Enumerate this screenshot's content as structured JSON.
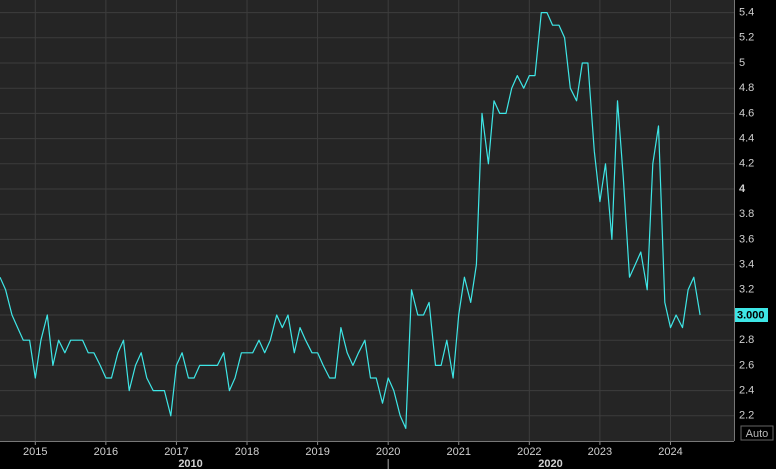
{
  "chart_data": {
    "type": "line",
    "title": "",
    "xlabel": "",
    "ylabel": "",
    "ylim": [
      2.0,
      5.5
    ],
    "yticks": [
      2.2,
      2.4,
      2.6,
      2.8,
      3.0,
      3.2,
      3.4,
      3.6,
      3.8,
      4.0,
      4.2,
      4.4,
      4.6,
      4.8,
      5.0,
      5.2,
      5.4
    ],
    "ytick_labels": [
      "2.2",
      "2.4",
      "2.6",
      "2.8",
      "3",
      "3.2",
      "3.4",
      "3.6",
      "3.8",
      "4",
      "4.2",
      "4.4",
      "4.6",
      "4.8",
      "5",
      "5.2",
      "5.4"
    ],
    "xticks": [
      2015,
      2016,
      2017,
      2018,
      2019,
      2020,
      2021,
      2022,
      2023,
      2024
    ],
    "xtick_labels": [
      "2015",
      "2016",
      "2017",
      "2018",
      "2019",
      "2020",
      "2021",
      "2022",
      "2023",
      "2024"
    ],
    "xlim": [
      2014.5,
      2024.9
    ],
    "decade_labels": [
      {
        "label": "2010",
        "x": 2017.2
      },
      {
        "label": "2020",
        "x": 2022.3
      }
    ],
    "decade_separator_x": 2020.0,
    "last_value_label": "3.000",
    "last_value": 3.0,
    "auto_label": "Auto",
    "grid": true,
    "line_color": "#3EE6E6",
    "series": [
      {
        "x": [
          2014.5,
          2014.58,
          2014.67,
          2014.75,
          2014.83,
          2014.92,
          2015.0,
          2015.08,
          2015.17,
          2015.25,
          2015.33,
          2015.42,
          2015.5,
          2015.58,
          2015.67,
          2015.75,
          2015.83,
          2015.92,
          2016.0,
          2016.08,
          2016.17,
          2016.25,
          2016.33,
          2016.42,
          2016.5,
          2016.58,
          2016.67,
          2016.75,
          2016.83,
          2016.92,
          2017.0,
          2017.08,
          2017.17,
          2017.25,
          2017.33,
          2017.42,
          2017.5,
          2017.58,
          2017.67,
          2017.75,
          2017.83,
          2017.92,
          2018.0,
          2018.08,
          2018.17,
          2018.25,
          2018.33,
          2018.42,
          2018.5,
          2018.58,
          2018.67,
          2018.75,
          2018.83,
          2018.92,
          2019.0,
          2019.08,
          2019.17,
          2019.25,
          2019.33,
          2019.42,
          2019.5,
          2019.58,
          2019.67,
          2019.75,
          2019.83,
          2019.92,
          2020.0,
          2020.08,
          2020.17,
          2020.25,
          2020.33,
          2020.42,
          2020.5,
          2020.58,
          2020.67,
          2020.75,
          2020.83,
          2020.92,
          2021.0,
          2021.08,
          2021.17,
          2021.25,
          2021.33,
          2021.42,
          2021.5,
          2021.58,
          2021.67,
          2021.75,
          2021.83,
          2021.92,
          2022.0,
          2022.08,
          2022.17,
          2022.25,
          2022.33,
          2022.42,
          2022.5,
          2022.58,
          2022.67,
          2022.75,
          2022.83,
          2022.92,
          2023.0,
          2023.08,
          2023.17,
          2023.25,
          2023.33,
          2023.42,
          2023.5,
          2023.58,
          2023.67,
          2023.75,
          2023.83,
          2023.92,
          2024.0,
          2024.08,
          2024.17,
          2024.25,
          2024.33,
          2024.42
        ],
        "values": [
          3.3,
          3.2,
          3.0,
          2.9,
          2.8,
          2.8,
          2.5,
          2.8,
          3.0,
          2.6,
          2.8,
          2.7,
          2.8,
          2.8,
          2.8,
          2.7,
          2.7,
          2.6,
          2.5,
          2.5,
          2.7,
          2.8,
          2.4,
          2.6,
          2.7,
          2.5,
          2.4,
          2.4,
          2.4,
          2.2,
          2.6,
          2.7,
          2.5,
          2.5,
          2.6,
          2.6,
          2.6,
          2.6,
          2.7,
          2.4,
          2.5,
          2.7,
          2.7,
          2.7,
          2.8,
          2.7,
          2.8,
          3.0,
          2.9,
          3.0,
          2.7,
          2.9,
          2.8,
          2.7,
          2.7,
          2.6,
          2.5,
          2.5,
          2.9,
          2.7,
          2.6,
          2.7,
          2.8,
          2.5,
          2.5,
          2.3,
          2.5,
          2.4,
          2.2,
          2.1,
          3.2,
          3.0,
          3.0,
          3.1,
          2.6,
          2.6,
          2.8,
          2.5,
          3.0,
          3.3,
          3.1,
          3.4,
          4.6,
          4.2,
          4.7,
          4.6,
          4.6,
          4.8,
          4.9,
          4.8,
          4.9,
          4.9,
          5.4,
          5.4,
          5.3,
          5.3,
          5.2,
          4.8,
          4.7,
          5.0,
          5.0,
          4.3,
          3.9,
          4.2,
          3.6,
          4.7,
          4.1,
          3.3,
          3.4,
          3.5,
          3.2,
          4.2,
          4.5,
          3.1,
          2.9,
          3.0,
          2.9,
          3.2,
          3.3,
          3.0
        ]
      }
    ]
  }
}
